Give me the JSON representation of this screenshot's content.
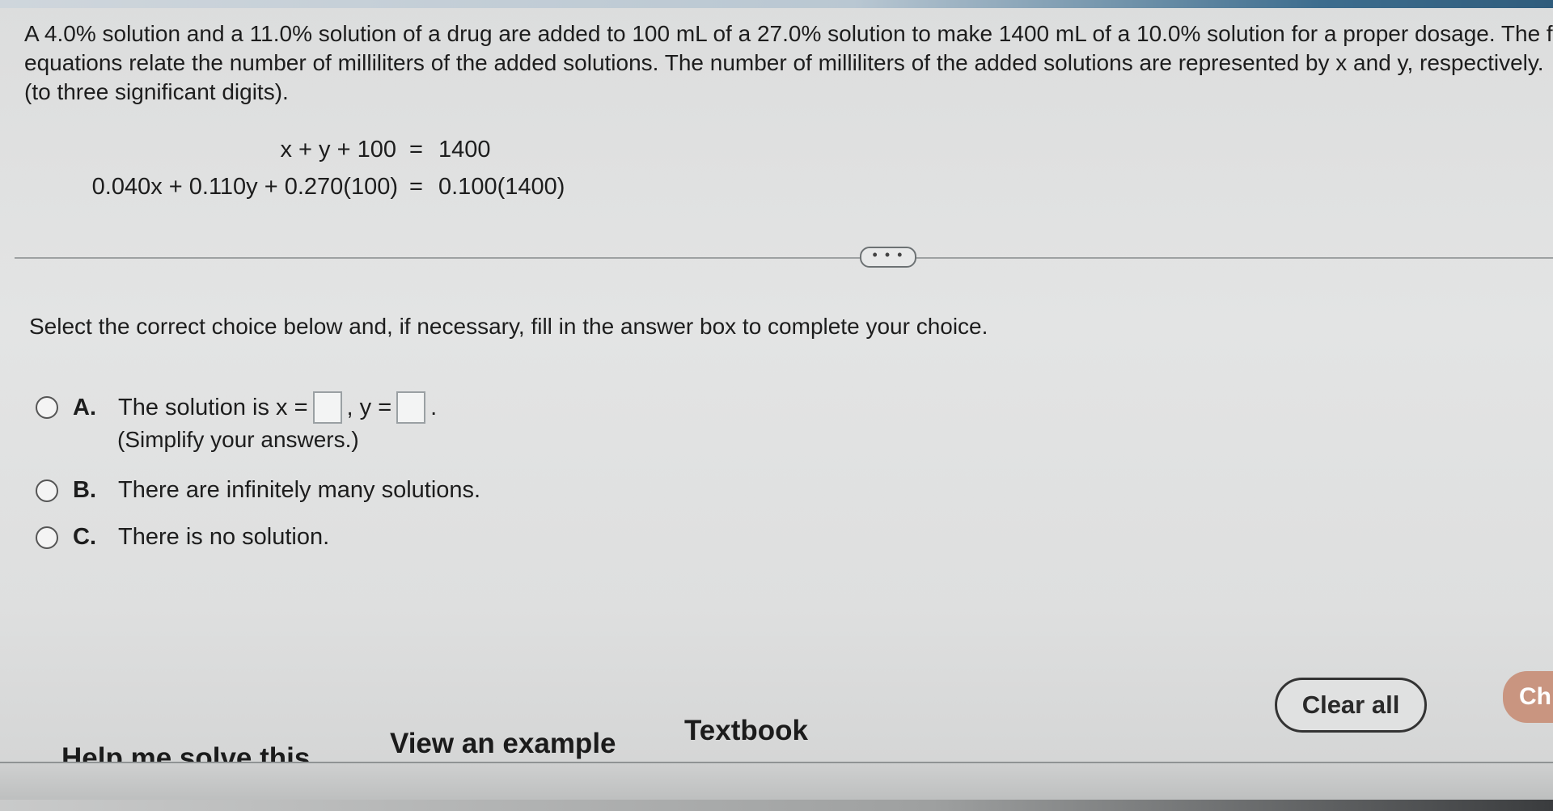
{
  "problem": {
    "line1": "A 4.0% solution and a 11.0% solution of a drug are added to 100 mL of a 27.0% solution to make 1400 mL of a 10.0% solution for a proper dosage. The f",
    "line2": "equations relate the number of milliliters of the added solutions. The number of milliliters of the added solutions are represented by x and y, respectively.",
    "line3": "(to three significant digits)."
  },
  "equations": [
    {
      "lhs": "x + y + 100",
      "eq": "=",
      "rhs": "1400"
    },
    {
      "lhs": "0.040x + 0.110y + 0.270(100)",
      "eq": "=",
      "rhs": "0.100(1400)"
    }
  ],
  "more_button": "• • •",
  "instruction": "Select the correct choice below and, if necessary, fill in the answer box to complete your choice.",
  "choices": {
    "a": {
      "letter": "A.",
      "text_pre": "The solution is x =",
      "sep": ", y =",
      "end": ".",
      "note": "(Simplify your answers.)"
    },
    "b": {
      "letter": "B.",
      "text": "There are infinitely many solutions."
    },
    "c": {
      "letter": "C.",
      "text": "There is no solution."
    }
  },
  "footer": {
    "help": "Help me solve this",
    "example": "View an example",
    "textbook": "Textbook",
    "clear": "Clear all",
    "check": "Ch"
  },
  "colors": {
    "check_button": "#c99580",
    "topbar_accent": "#2f5c7c"
  }
}
